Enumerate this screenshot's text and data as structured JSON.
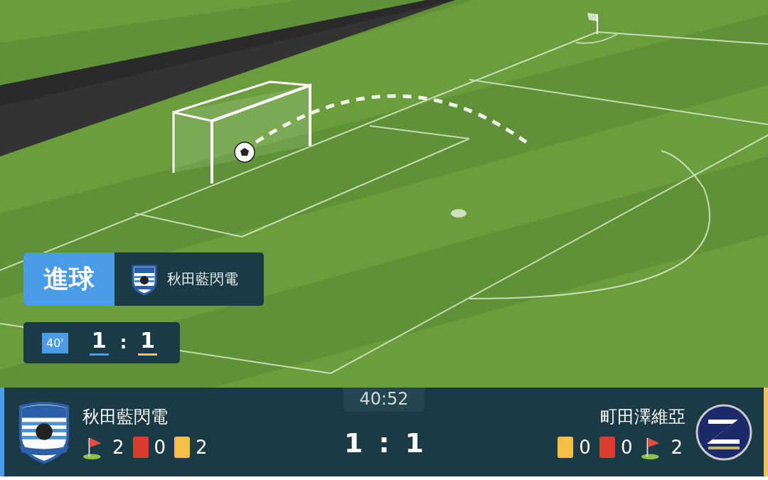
{
  "event": {
    "label": "進球",
    "team": "秋田藍閃電",
    "minute": "40'",
    "home_score": "1",
    "separator": ":",
    "away_score": "1"
  },
  "match": {
    "clock": "40:52",
    "home_score": "1",
    "separator": ":",
    "away_score": "1"
  },
  "teams": [
    {
      "name": "秋田藍閃電",
      "color": "#4a9be8",
      "stats": [
        {
          "kind": "corner",
          "value": "2"
        },
        {
          "kind": "red",
          "value": "0"
        },
        {
          "kind": "yellow",
          "value": "2"
        }
      ]
    },
    {
      "name": "町田澤維亞",
      "color": "#f5c060",
      "stats": [
        {
          "kind": "yellow",
          "value": "0"
        },
        {
          "kind": "red",
          "value": "0"
        },
        {
          "kind": "corner",
          "value": "2"
        }
      ]
    }
  ]
}
